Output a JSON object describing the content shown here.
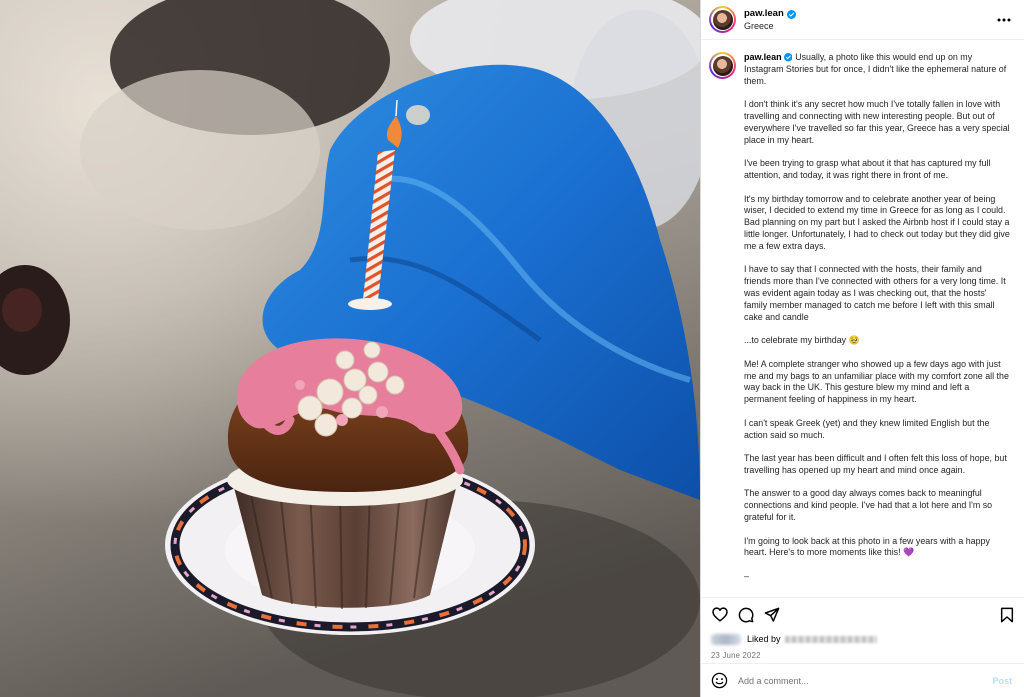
{
  "post": {
    "username": "paw.lean",
    "location": "Greece",
    "more_icon": "more-horizontal-icon",
    "verified_icon": "verified-badge-icon"
  },
  "caption": {
    "username": "paw.lean",
    "paragraphs": [
      "Usually, a photo like this would end up on my Instagram Stories but for once, I didn't like the ephemeral nature of them.",
      "I don't think it's any secret how much I've totally fallen in love with travelling and connecting with new interesting people. But out of everywhere I've travelled so far this year, Greece has a very special place in my heart.",
      "I've been trying to grasp what about it that has captured my full attention, and today, it was right there in front of me.",
      "It's my birthday tomorrow and to celebrate another year of being wiser, I decided to extend my time in Greece for as long as I could. Bad planning on my part but I asked the Airbnb host if I could stay a little longer. Unfortunately, I had to check out today but they did give me a few extra days.",
      "I have to say that I connected with the hosts, their family and friends more than I've connected with others for a very long time. It was evident again today as I was checking out, that the hosts' family member managed to catch me before I left with this small cake and candle",
      "...to celebrate my birthday 🥹",
      "Me! A complete stranger who showed up a few days ago with just me and my bags to an unfamiliar place with my comfort zone all the way back in the UK. This gesture blew my mind and left a permanent feeling of happiness in my heart.",
      "I can't speak Greek (yet) and they knew limited English but the action said so much.",
      "The last year has been difficult and I often felt this loss of hope, but travelling has opened up my heart and mind once again.",
      "The answer to a good day always comes back to meaningful connections and kind people. I've had that a lot here and I'm so grateful for it.",
      "I'm going to look back at this photo in a few years with a happy heart. Here's to more moments like this! 💜",
      "–"
    ]
  },
  "actions": {
    "like_icon": "heart-icon",
    "comment_icon": "comment-bubble-icon",
    "share_icon": "paper-plane-icon",
    "save_icon": "bookmark-icon"
  },
  "likes": {
    "label": "Liked by"
  },
  "date": "23 June 2022",
  "comment_box": {
    "emoji_icon": "emoji-smiley-icon",
    "placeholder": "Add a comment...",
    "post_label": "Post",
    "post_color": "#b2dffc"
  },
  "colors": {
    "verified": "#0095f6",
    "border": "#dbdbdb",
    "muted": "#737373"
  }
}
